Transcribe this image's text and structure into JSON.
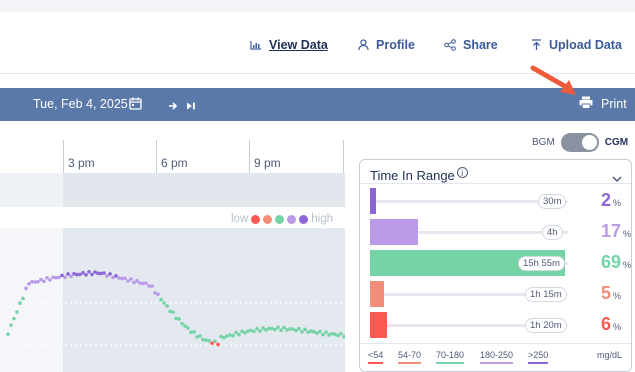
{
  "nav": {
    "items": [
      {
        "label": "View Data",
        "icon": "bar-chart-icon",
        "active": true
      },
      {
        "label": "Profile",
        "icon": "person-icon",
        "active": false
      },
      {
        "label": "Share",
        "icon": "share-icon",
        "active": false
      },
      {
        "label": "Upload Data",
        "icon": "upload-icon",
        "active": false
      }
    ]
  },
  "toolbar": {
    "date": "Tue, Feb 4, 2025",
    "calendar_icon": "calendar-icon",
    "next_icon": "arrow-right-icon",
    "last_icon": "skip-to-end-icon",
    "print_label": "Print",
    "print_icon": "printer-icon",
    "color": "#5a79a8"
  },
  "time_axis": {
    "labels": [
      "3 pm",
      "6 pm",
      "9 pm"
    ]
  },
  "glucose_legend": {
    "low_label": "low",
    "high_label": "high",
    "colors": [
      "#fb5951",
      "#f28d79",
      "#76d3a6",
      "#bb9ae7",
      "#8c65d6"
    ]
  },
  "toggle": {
    "off_label": "BGM",
    "on_label": "CGM",
    "state": "CGM"
  },
  "time_in_range": {
    "title": "Time In Range",
    "info_icon": "info-icon",
    "collapse_icon": "chevron-down-icon",
    "rows": [
      {
        "range": "<54",
        "duration": "30m",
        "percent": "2",
        "value": 2,
        "color": "#8c65d6"
      },
      {
        "range": "54-70",
        "duration": "4h",
        "percent": "17",
        "value": 17,
        "color": "#bb9ae7"
      },
      {
        "range": "70-180",
        "duration": "15h 55m",
        "percent": "69",
        "value": 69,
        "color": "#76d3a6"
      },
      {
        "range": "180-250",
        "duration": "1h 15m",
        "percent": "5",
        "value": 5,
        "color": "#f28d79"
      },
      {
        "range": ">250",
        "duration": "1h 20m",
        "percent": "6",
        "value": 6,
        "color": "#fb5951"
      }
    ],
    "percent_symbol": "%",
    "footer_ranges": [
      {
        "label": "<54",
        "color": "#fb5951"
      },
      {
        "label": "54-70",
        "color": "#f28d79"
      },
      {
        "label": "70-180",
        "color": "#76d3a6"
      },
      {
        "label": "180-250",
        "color": "#bb9ae7"
      },
      {
        "label": ">250",
        "color": "#8c65d6"
      }
    ],
    "unit": "mg/dL"
  }
}
